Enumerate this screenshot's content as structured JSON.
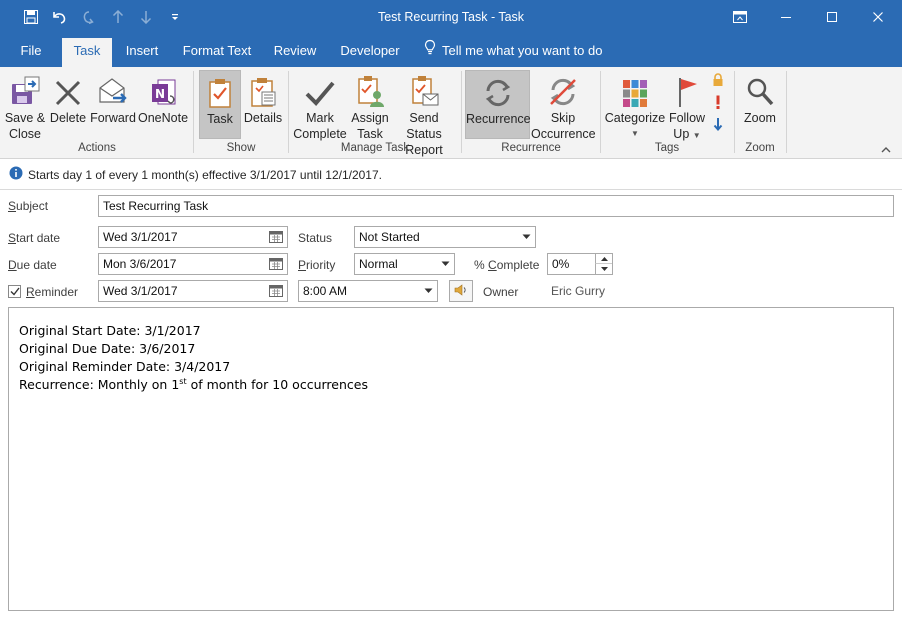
{
  "window": {
    "title": "Test Recurring Task  -  Task",
    "qat": [
      "save-icon",
      "undo-icon",
      "redo-icon",
      "up-arrow-icon",
      "down-arrow-icon",
      "customize-qat-icon"
    ],
    "controls": [
      "ribbon-display-options-icon",
      "minimize-icon",
      "maximize-icon",
      "close-icon"
    ]
  },
  "tabs": [
    {
      "label": "File"
    },
    {
      "label": "Task"
    },
    {
      "label": "Insert"
    },
    {
      "label": "Format Text"
    },
    {
      "label": "Review"
    },
    {
      "label": "Developer"
    }
  ],
  "tell_me": "Tell me what you want to do",
  "ribbon": {
    "actions": {
      "label": "Actions",
      "save_close": {
        "line1": "Save &",
        "line2": "Close"
      },
      "delete": "Delete",
      "forward": "Forward",
      "onenote": "OneNote"
    },
    "show": {
      "label": "Show",
      "task": "Task",
      "details": "Details"
    },
    "manage": {
      "label": "Manage Task",
      "mark_complete": {
        "line1": "Mark",
        "line2": "Complete"
      },
      "assign_task": {
        "line1": "Assign",
        "line2": "Task"
      },
      "send_status": {
        "line1": "Send Status",
        "line2": "Report"
      }
    },
    "recurrence": {
      "label": "Recurrence",
      "recurrence": "Recurrence",
      "skip": {
        "line1": "Skip",
        "line2": "Occurrence"
      }
    },
    "tags": {
      "label": "Tags",
      "categorize": "Categorize",
      "follow_up": {
        "line1": "Follow",
        "line2": "Up"
      }
    },
    "zoom": {
      "label": "Zoom",
      "zoom": "Zoom"
    }
  },
  "info_bar": "Starts day 1 of every 1 month(s) effective 3/1/2017 until 12/1/2017.",
  "form": {
    "subject": {
      "label_ul": "S",
      "label_rest": "ubject",
      "value": "Test Recurring Task"
    },
    "start_date": {
      "label_ul": "S",
      "label_rest": "tart date",
      "value": "Wed 3/1/2017"
    },
    "due_date": {
      "label_ul": "D",
      "label_rest": "ue date",
      "value": "Mon 3/6/2017"
    },
    "reminder": {
      "label_ul": "R",
      "label_rest": "eminder",
      "checked": true,
      "date": "Wed 3/1/2017",
      "time": "8:00 AM"
    },
    "status": {
      "label": "Status",
      "value": "Not Started"
    },
    "priority": {
      "label_ul": "P",
      "label_rest": "riority",
      "value": "Normal"
    },
    "percent": {
      "label_pre": "% ",
      "label_ul": "C",
      "label_rest": "omplete",
      "value": "0%"
    },
    "owner": {
      "label": "Owner",
      "value": "Eric Gurry"
    }
  },
  "notes": {
    "line1": "Original Start Date: 3/1/2017",
    "line2": "Original Due Date: 3/6/2017",
    "line3": "Original Reminder Date: 3/4/2017",
    "line4_pre": "Recurrence: Monthly on 1",
    "line4_sup": "st",
    "line4_post": " of month for 10 occurrences"
  },
  "colors": {
    "title_bar": "#2b6bb4",
    "ribbon_bg": "#f3f3f3",
    "selected_button": "#c5c5c5"
  }
}
